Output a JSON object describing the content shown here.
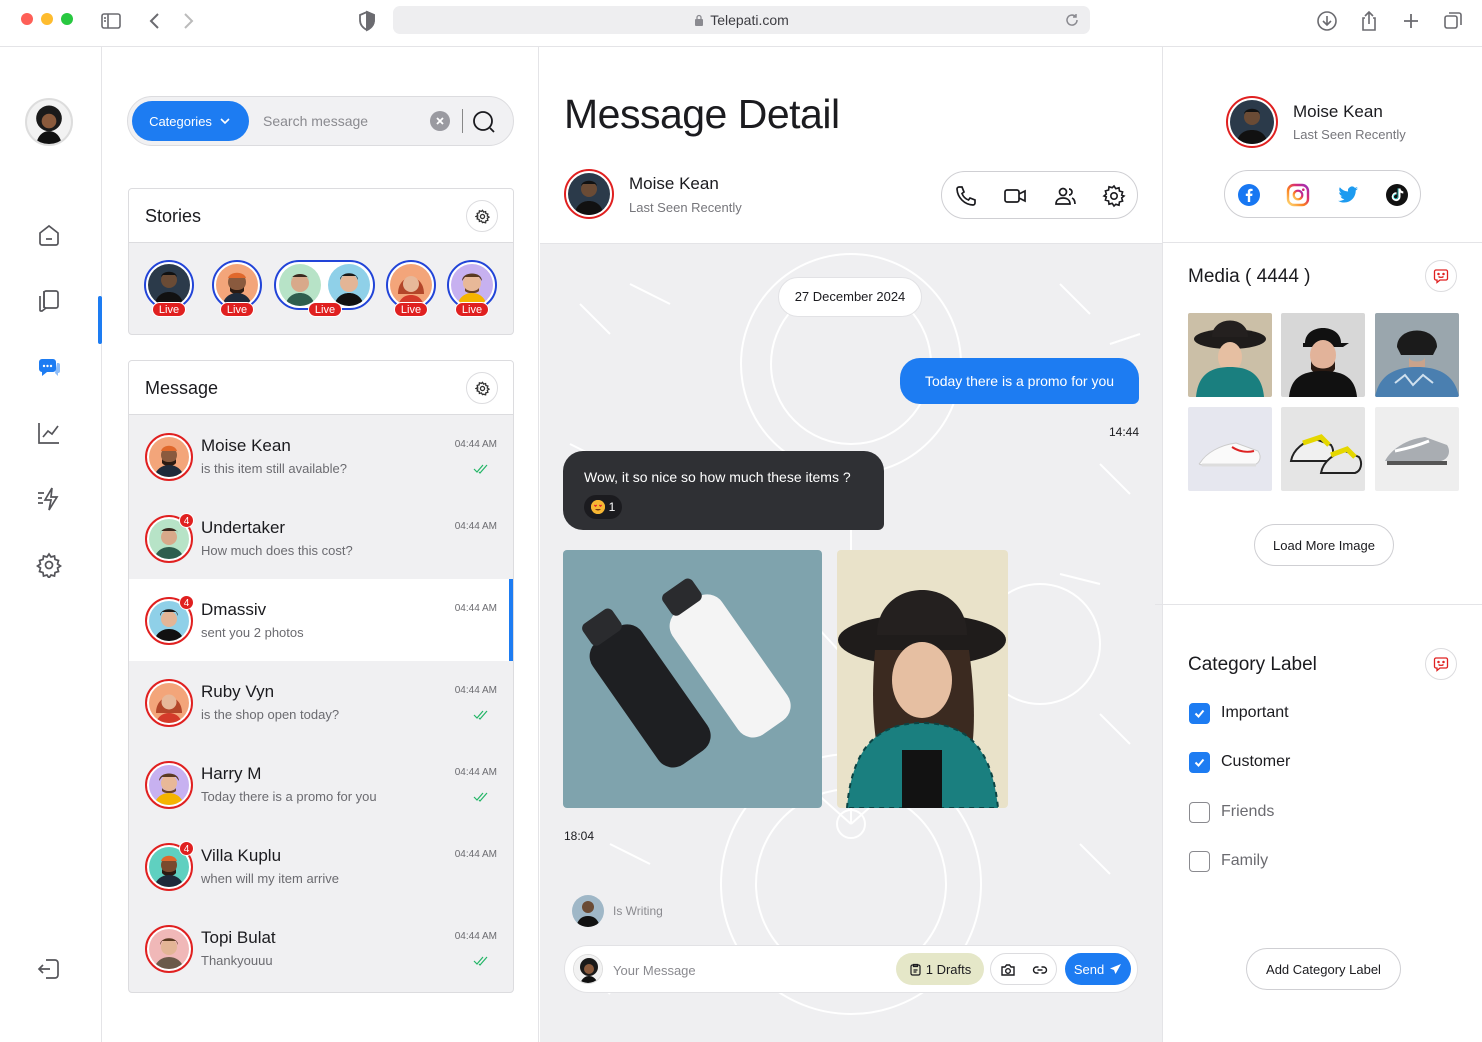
{
  "browser": {
    "url": "Telepati.com"
  },
  "sidebar": {
    "items": [
      "home-icon",
      "book-icon",
      "chat-icon",
      "chart-icon",
      "flash-icon",
      "gear-icon"
    ],
    "logout": "logout-icon"
  },
  "search": {
    "category_label": "Categories",
    "placeholder": "Search message"
  },
  "stories": {
    "title": "Stories",
    "live_label": "Live",
    "items": [
      {
        "live": true
      },
      {
        "live": true
      },
      {
        "live": true,
        "pair": true
      },
      {
        "live": true
      },
      {
        "live": true
      }
    ]
  },
  "messages": {
    "title": "Message",
    "items": [
      {
        "name": "Moise Kean",
        "preview": "is this item still available?",
        "time": "04:44 AM",
        "unread": "",
        "read": true
      },
      {
        "name": "Undertaker",
        "preview": "How much does this cost?",
        "time": "04:44 AM",
        "unread": "4",
        "read": false
      },
      {
        "name": "Dmassiv",
        "preview": "sent you 2 photos",
        "time": "04:44 AM",
        "unread": "4",
        "read": false,
        "active": true
      },
      {
        "name": "Ruby Vyn",
        "preview": "is the shop open today?",
        "time": "04:44 AM",
        "unread": "",
        "read": true
      },
      {
        "name": "Harry M",
        "preview": "Today there is a promo for you",
        "time": "04:44 AM",
        "unread": "",
        "read": true
      },
      {
        "name": "Villa Kuplu",
        "preview": "when will my item arrive",
        "time": "04:44 AM",
        "unread": "4",
        "read": false
      },
      {
        "name": "Topi Bulat",
        "preview": "Thankyouuu",
        "time": "04:44 AM",
        "unread": "",
        "read": true
      }
    ]
  },
  "detail": {
    "title": "Message Detail",
    "contact_name": "Moise Kean",
    "contact_status": "Last Seen Recently",
    "date": "27 December 2024",
    "outgoing_text": "Today there is a promo for you",
    "outgoing_time": "14:44",
    "incoming_text": "Wow, it so nice so how much these items ?",
    "reaction_count": "1",
    "photos_time": "18:04",
    "typing_text": "Is Writing",
    "composer_placeholder": "Your Message",
    "drafts_label": "1 Drafts",
    "send_label": "Send"
  },
  "profile": {
    "name": "Moise Kean",
    "status": "Last Seen Recently",
    "socials": [
      "facebook-icon",
      "instagram-icon",
      "twitter-icon",
      "tiktok-icon"
    ],
    "media_title": "Media ( 4444 )",
    "load_more_label": "Load More Image",
    "category_title": "Category Label",
    "categories": [
      {
        "label": "Important",
        "checked": true
      },
      {
        "label": "Customer",
        "checked": true
      },
      {
        "label": "Friends",
        "checked": false
      },
      {
        "label": "Family",
        "checked": false
      }
    ],
    "add_category_label": "Add Category Label"
  },
  "colors": {
    "accent": "#1d7cf2",
    "alert": "#e02020",
    "drafts": "#e5e7c8",
    "incoming_bubble": "#2f3034"
  }
}
